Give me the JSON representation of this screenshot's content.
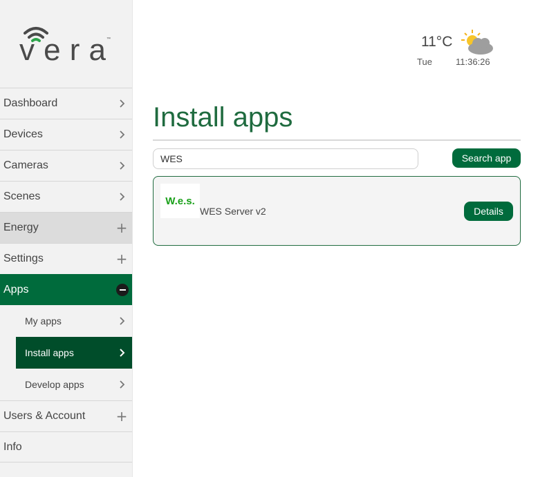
{
  "brand": {
    "logo_text": "vera",
    "accent_color": "#006b3c",
    "dark_accent_color": "#004d2a"
  },
  "weather": {
    "temperature": "11°C",
    "day": "Tue",
    "time": "11:36:26",
    "icon": "partly-cloudy-icon"
  },
  "sidebar": {
    "items": [
      {
        "label": "Dashboard",
        "icon": "chevron-right-icon"
      },
      {
        "label": "Devices",
        "icon": "chevron-right-icon"
      },
      {
        "label": "Cameras",
        "icon": "chevron-right-icon"
      },
      {
        "label": "Scenes",
        "icon": "chevron-right-icon"
      },
      {
        "label": "Energy",
        "icon": "plus-icon"
      },
      {
        "label": "Settings",
        "icon": "plus-icon"
      },
      {
        "label": "Apps",
        "icon": "minus-circle-icon"
      },
      {
        "label": "Users & Account",
        "icon": "plus-icon"
      },
      {
        "label": "Info",
        "icon": ""
      }
    ],
    "apps_sub": [
      {
        "label": "My apps",
        "icon": "chevron-right-icon"
      },
      {
        "label": "Install apps",
        "icon": "chevron-right-icon",
        "active": true
      },
      {
        "label": "Develop apps",
        "icon": "chevron-right-icon"
      }
    ]
  },
  "main": {
    "title": "Install apps",
    "search": {
      "value": "WES",
      "button_label": "Search app"
    },
    "results": [
      {
        "logo_text": "W.e.s.",
        "name": "WES Server v2",
        "button_label": "Details"
      }
    ]
  }
}
